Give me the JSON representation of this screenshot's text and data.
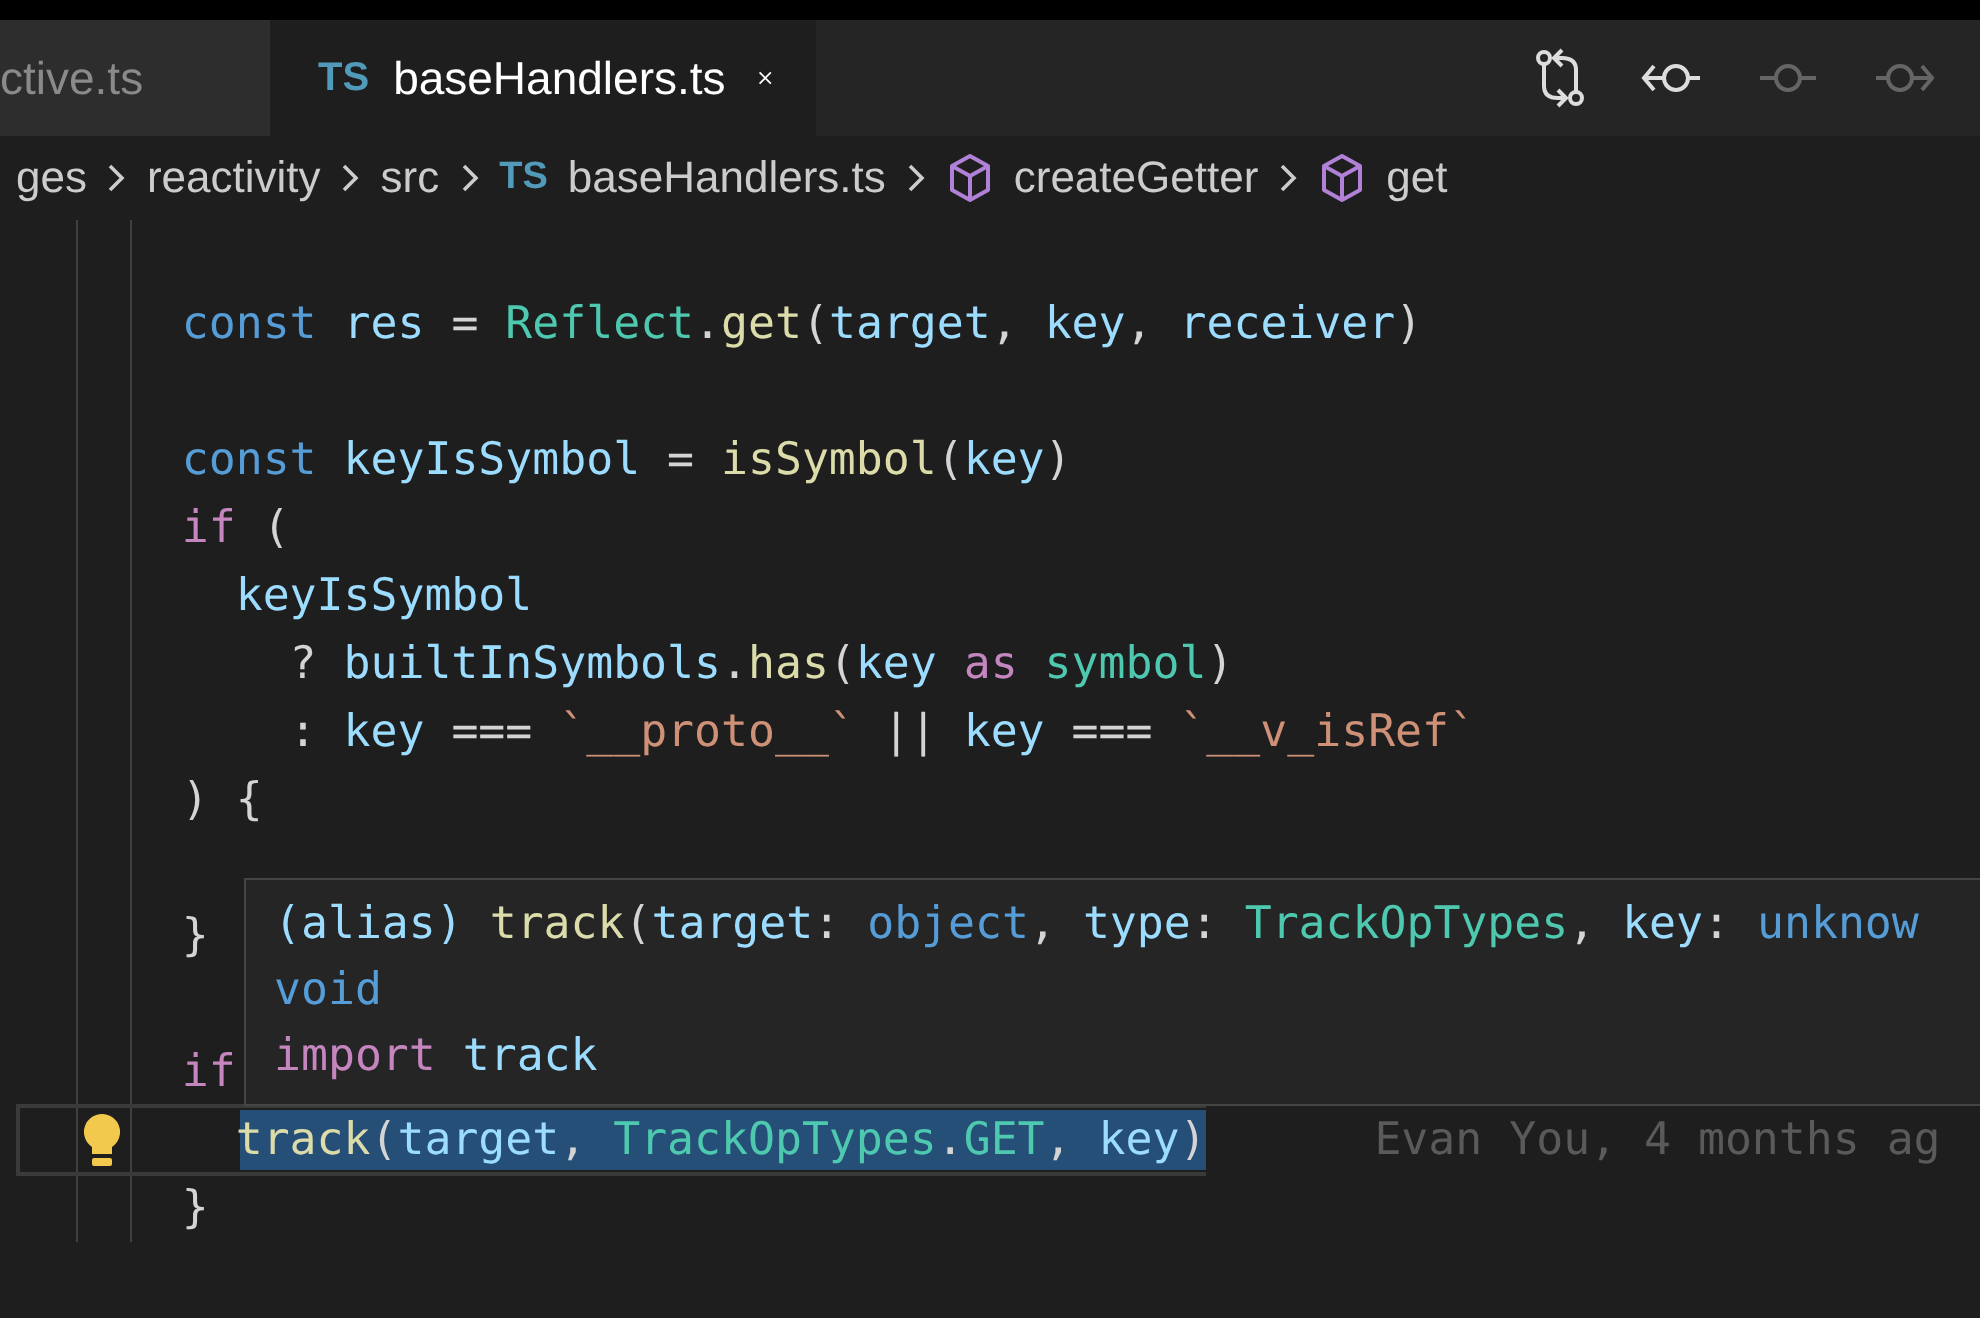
{
  "tabs": [
    {
      "label": "ctive.ts",
      "selected": false
    },
    {
      "label": "baseHandlers.ts",
      "badge": "TS",
      "selected": true
    }
  ],
  "toolbar": [
    {
      "kind": "compare",
      "disabled": false
    },
    {
      "kind": "back",
      "disabled": false
    },
    {
      "kind": "commit",
      "disabled": true
    },
    {
      "kind": "forward",
      "disabled": true
    }
  ],
  "breadcrumbs": [
    {
      "label": "ges",
      "kind": "folder"
    },
    {
      "label": "reactivity",
      "kind": "folder"
    },
    {
      "label": "src",
      "kind": "folder"
    },
    {
      "label": "baseHandlers.ts",
      "kind": "file",
      "badge": "TS"
    },
    {
      "label": "createGetter",
      "kind": "symbol"
    },
    {
      "label": "get",
      "kind": "symbol"
    }
  ],
  "lines": [
    {
      "kind": "blank"
    },
    {
      "kind": "code",
      "tokens": [
        {
          "text": "      const",
          "kind": "keyword"
        },
        {
          "text": " res ",
          "kind": "variable"
        },
        {
          "text": "= ",
          "kind": "plain"
        },
        {
          "text": "Reflect",
          "kind": "type"
        },
        {
          "text": ".",
          "kind": "plain"
        },
        {
          "text": "get",
          "kind": "function"
        },
        {
          "text": "(",
          "kind": "plain"
        },
        {
          "text": "target",
          "kind": "variable"
        },
        {
          "text": ", ",
          "kind": "plain"
        },
        {
          "text": "key",
          "kind": "variable"
        },
        {
          "text": ", ",
          "kind": "plain"
        },
        {
          "text": "receiver",
          "kind": "variable"
        },
        {
          "text": ")",
          "kind": "plain"
        }
      ]
    },
    {
      "kind": "blank"
    },
    {
      "kind": "code",
      "tokens": [
        {
          "text": "      const",
          "kind": "keyword"
        },
        {
          "text": " keyIsSymbol ",
          "kind": "variable"
        },
        {
          "text": "= ",
          "kind": "plain"
        },
        {
          "text": "isSymbol",
          "kind": "function"
        },
        {
          "text": "(",
          "kind": "plain"
        },
        {
          "text": "key",
          "kind": "variable"
        },
        {
          "text": ")",
          "kind": "plain"
        }
      ]
    },
    {
      "kind": "code",
      "tokens": [
        {
          "text": "      if",
          "kind": "control"
        },
        {
          "text": " (",
          "kind": "plain"
        }
      ]
    },
    {
      "kind": "code",
      "tokens": [
        {
          "text": "        keyIsSymbol",
          "kind": "variable"
        }
      ]
    },
    {
      "kind": "code",
      "tokens": [
        {
          "text": "          ? ",
          "kind": "plain"
        },
        {
          "text": "builtInSymbols",
          "kind": "variable"
        },
        {
          "text": ".",
          "kind": "plain"
        },
        {
          "text": "has",
          "kind": "function"
        },
        {
          "text": "(",
          "kind": "plain"
        },
        {
          "text": "key",
          "kind": "variable"
        },
        {
          "text": " as ",
          "kind": "control"
        },
        {
          "text": "symbol",
          "kind": "type"
        },
        {
          "text": ")",
          "kind": "plain"
        }
      ]
    },
    {
      "kind": "code",
      "tokens": [
        {
          "text": "          : ",
          "kind": "plain"
        },
        {
          "text": "key",
          "kind": "variable"
        },
        {
          "text": " === ",
          "kind": "plain"
        },
        {
          "text": "`__proto__`",
          "kind": "string"
        },
        {
          "text": " || ",
          "kind": "plain"
        },
        {
          "text": "key",
          "kind": "variable"
        },
        {
          "text": " === ",
          "kind": "plain"
        },
        {
          "text": "`__v_isRef`",
          "kind": "string"
        }
      ]
    },
    {
      "kind": "code",
      "tokens": [
        {
          "text": "      ) {",
          "kind": "plain"
        }
      ]
    },
    {
      "kind": "blank"
    },
    {
      "kind": "code",
      "tokens": [
        {
          "text": "      }",
          "kind": "plain"
        }
      ]
    },
    {
      "kind": "blank"
    },
    {
      "kind": "code",
      "tokens": [
        {
          "text": "      if",
          "kind": "control"
        }
      ]
    },
    {
      "kind": "code",
      "selection": true,
      "current": true,
      "blame": "Evan You, 4 months ag",
      "tokens": [
        {
          "text": "        track",
          "kind": "function"
        },
        {
          "text": "(",
          "kind": "plain"
        },
        {
          "text": "target",
          "kind": "variable"
        },
        {
          "text": ", ",
          "kind": "plain"
        },
        {
          "text": "TrackOpTypes",
          "kind": "type"
        },
        {
          "text": ".",
          "kind": "plain"
        },
        {
          "text": "GET",
          "kind": "type"
        },
        {
          "text": ", ",
          "kind": "plain"
        },
        {
          "text": "key",
          "kind": "variable"
        },
        {
          "text": ")",
          "kind": "plain"
        }
      ]
    },
    {
      "kind": "code",
      "tokens": [
        {
          "text": "      }",
          "kind": "plain"
        }
      ]
    }
  ],
  "hover": {
    "lines": [
      [
        {
          "text": "(alias) ",
          "kind": "variable"
        },
        {
          "text": "track",
          "kind": "function"
        },
        {
          "text": "(",
          "kind": "plain"
        },
        {
          "text": "target",
          "kind": "variable"
        },
        {
          "text": ": ",
          "kind": "plain"
        },
        {
          "text": "object",
          "kind": "keyword"
        },
        {
          "text": ", ",
          "kind": "plain"
        },
        {
          "text": "type",
          "kind": "variable"
        },
        {
          "text": ": ",
          "kind": "plain"
        },
        {
          "text": "TrackOpTypes",
          "kind": "type"
        },
        {
          "text": ", ",
          "kind": "plain"
        },
        {
          "text": "key",
          "kind": "variable"
        },
        {
          "text": ": ",
          "kind": "plain"
        },
        {
          "text": "unknow",
          "kind": "keyword"
        }
      ],
      [
        {
          "text": "void",
          "kind": "keyword"
        }
      ],
      [
        {
          "text": "import",
          "kind": "control"
        },
        {
          "text": " track",
          "kind": "variable"
        }
      ]
    ]
  }
}
